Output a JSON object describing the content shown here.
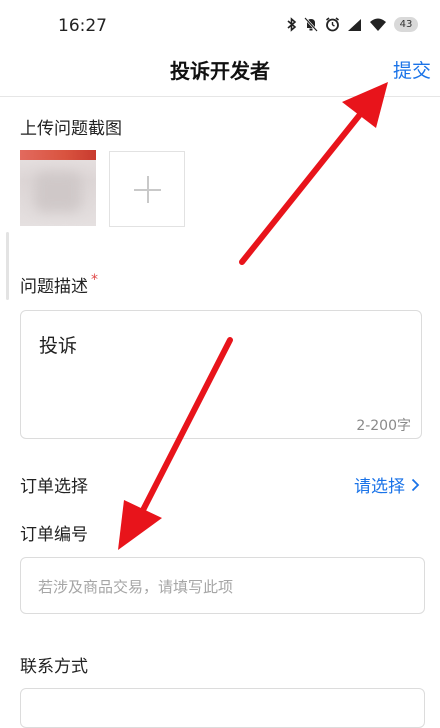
{
  "status_bar": {
    "time": "16:27",
    "battery": "43",
    "icons": [
      "bluetooth-icon",
      "mute-icon",
      "alarm-icon",
      "signal-icon",
      "wifi-icon",
      "battery-icon"
    ]
  },
  "header": {
    "title": "投诉开发者",
    "submit_label": "提交"
  },
  "upload": {
    "label": "上传问题截图"
  },
  "description": {
    "label": "问题描述",
    "required_mark": "*",
    "value": "投诉",
    "counter": "2-200字"
  },
  "order_select": {
    "label": "订单选择",
    "action_label": "请选择"
  },
  "order_number": {
    "label": "订单编号",
    "placeholder": "若涉及商品交易，请填写此项"
  },
  "contact": {
    "label": "联系方式"
  },
  "colors": {
    "accent": "#1a73e8",
    "arrow": "#e8141b",
    "required": "#e04848"
  }
}
